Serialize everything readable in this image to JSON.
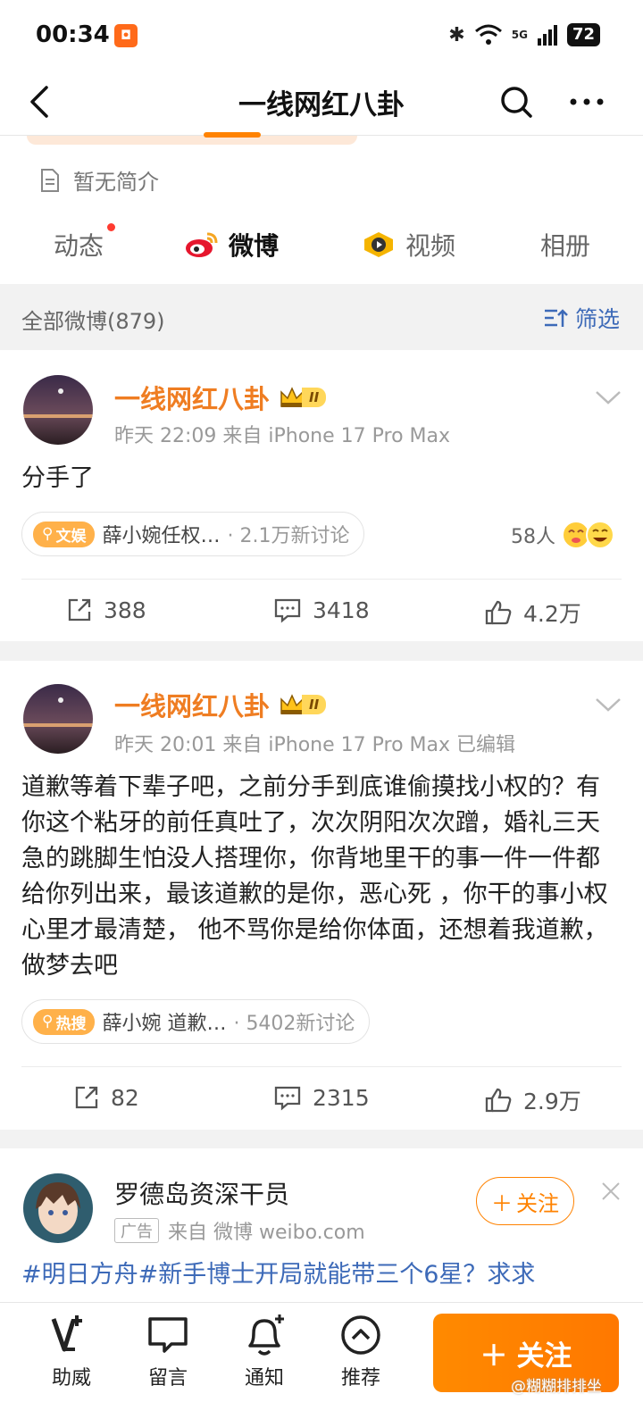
{
  "status_bar": {
    "time": "00:34",
    "network": "5G",
    "battery": "72"
  },
  "nav": {
    "title": "一线网红八卦"
  },
  "profile": {
    "intro": "暂无简介"
  },
  "tabs": [
    {
      "label": "动态",
      "has_dot": true
    },
    {
      "label": "微博",
      "active": true
    },
    {
      "label": "视频"
    },
    {
      "label": "相册"
    }
  ],
  "filter": {
    "label": "全部微博(879)",
    "button": "筛选"
  },
  "posts": [
    {
      "author": "一线网红八卦",
      "vip_level": "II",
      "meta": "昨天 22:09  来自 iPhone 17 Pro Max",
      "text": "分手了",
      "topic_badge": "文娱",
      "topic_text": "薛小婉任权…",
      "topic_count": "· 2.1万新讨论",
      "reactors": "58人",
      "repost": "388",
      "comment": "3418",
      "like": "4.2万"
    },
    {
      "author": "一线网红八卦",
      "vip_level": "II",
      "meta": "昨天 20:01  来自 iPhone 17 Pro Max  已编辑",
      "text": "道歉等着下辈子吧，之前分手到底谁偷摸找小权的？有你这个粘牙的前任真吐了，次次阴阳次次蹭，婚礼三天急的跳脚生怕没人搭理你，你背地里干的事一件一件都给你列出来，最该道歉的是你，恶心死 ，你干的事小权心里才最清楚， 他不骂你是给你体面，还想着我道歉，做梦去吧",
      "topic_badge": "热搜",
      "topic_text": "薛小婉 道歉…",
      "topic_count": "· 5402新讨论",
      "repost": "82",
      "comment": "2315",
      "like": "2.9万"
    }
  ],
  "ad": {
    "author": "罗德岛资深干员",
    "ad_tag": "广告",
    "meta": "来自 微博 weibo.com",
    "follow": "关注",
    "text": "#明日方舟#新手博士开局就能带三个6星？求求"
  },
  "bottom_bar": {
    "items": [
      "助威",
      "留言",
      "通知",
      "推荐"
    ],
    "follow": "关注"
  },
  "watermark": "@糊糊排排坐",
  "colors": {
    "accent": "#ff8200",
    "username": "#ef7d22",
    "link": "#3d6ab8"
  }
}
